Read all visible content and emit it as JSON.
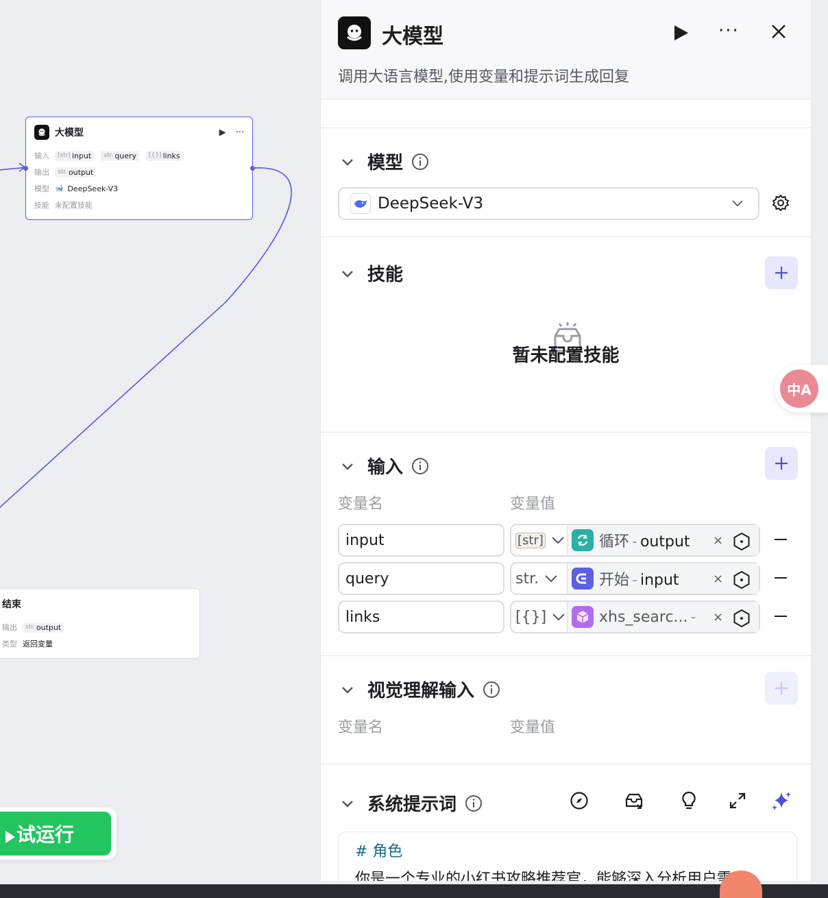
{
  "canvas": {
    "llm_node": {
      "title": "大模型",
      "input_label": "输入",
      "inputs": [
        {
          "type": "[str]",
          "name": "input"
        },
        {
          "type": "str.",
          "name": "query"
        },
        {
          "type": "[{}]",
          "name": "links"
        }
      ],
      "output_label": "输出",
      "output": {
        "type": "str.",
        "name": "output"
      },
      "model_label": "模型",
      "model": "DeepSeek-V3",
      "skill_label": "技能",
      "skill": "未配置技能"
    },
    "end_node": {
      "title": "结束",
      "output_label": "输出",
      "output": {
        "type": "str.",
        "name": "output"
      },
      "mode_label": "类型",
      "mode": "返回变量"
    },
    "run_button": "试运行"
  },
  "panel": {
    "title": "大模型",
    "description": "调用大语言模型,使用变量和提示词生成回复",
    "model_section": {
      "title": "模型",
      "selected": "DeepSeek-V3"
    },
    "skills_section": {
      "title": "技能",
      "empty_text": "暂未配置技能"
    },
    "input_section": {
      "title": "输入",
      "col_name": "变量名",
      "col_value": "变量值",
      "rows": [
        {
          "name": "input",
          "type": "[str]",
          "node": "循环",
          "sep": "-",
          "var": "output",
          "icon_color": "#2ab0a5"
        },
        {
          "name": "query",
          "type": "str.",
          "node": "开始",
          "sep": "-",
          "var": "input",
          "icon_color": "#5b5fe0"
        },
        {
          "name": "links",
          "type": "[{}]",
          "node": "xhs_searc...",
          "sep": "-",
          "var": "",
          "icon_color": "#b36cf0"
        }
      ]
    },
    "vision_section": {
      "title": "视觉理解输入",
      "col_name": "变量名",
      "col_value": "变量值"
    },
    "prompt_section": {
      "title": "系统提示词",
      "heading": "# 角色",
      "text": "你是一个专业的小红书攻略推荐官，能够深入分析用户需"
    }
  },
  "translate_button": "中A",
  "colors": {
    "accent": "#5b5fe0",
    "run_green": "#22c55e",
    "edge": "#4b50d9"
  }
}
